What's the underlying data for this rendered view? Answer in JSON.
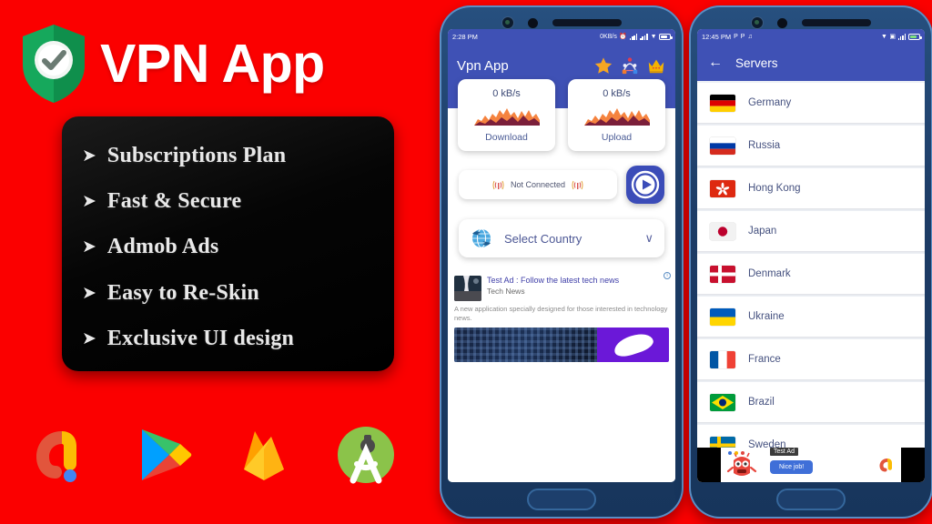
{
  "background_color": "#fb0000",
  "brand": {
    "icon": "shield-check-icon",
    "title": "VPN App"
  },
  "features": {
    "bullet": "➤",
    "items": [
      "Subscriptions Plan",
      "Fast & Secure",
      "Admob Ads",
      "Easy to Re-Skin",
      "Exclusive UI design"
    ]
  },
  "tech_icons": [
    {
      "name": "admob-icon",
      "label": "AdMob"
    },
    {
      "name": "google-play-icon",
      "label": "Google Play"
    },
    {
      "name": "firebase-icon",
      "label": "Firebase"
    },
    {
      "name": "android-studio-icon",
      "label": "Android Studio"
    }
  ],
  "phone_home": {
    "statusbar": {
      "time": "2:28 PM",
      "network_speed": "0KB/s",
      "icons": [
        "alarm-icon",
        "signal-icon",
        "signal-icon",
        "wifi-icon",
        "battery-icon"
      ]
    },
    "appbar": {
      "title": "Vpn App",
      "icons": [
        "star-icon",
        "share-network-icon",
        "crown-icon"
      ]
    },
    "speed_cards": [
      {
        "value": "0 kB/s",
        "label": "Download",
        "graph": "sparkline-graph"
      },
      {
        "value": "0 kB/s",
        "label": "Upload",
        "graph": "sparkline-graph"
      }
    ],
    "connection": {
      "status": "Not Connected",
      "left_icon": "antenna-icon",
      "right_icon": "antenna-icon",
      "play_button": "play-icon"
    },
    "country_selector": {
      "icon": "globe-icon",
      "label": "Select Country",
      "chevron": "∨"
    },
    "native_ad": {
      "info_badge": "i",
      "title": "Test Ad : Follow the latest tech news",
      "advertiser": "Tech News",
      "description": "A new application specially designed for those interested in technology news."
    }
  },
  "phone_servers": {
    "statusbar": {
      "time": "12:45 PM",
      "icons": [
        "p-icon",
        "p-icon",
        "vibrate-icon",
        "wifi-icon",
        "sim-icon",
        "signal-icon",
        "battery-icon"
      ]
    },
    "appbar": {
      "back_icon": "back-arrow-icon",
      "title": "Servers"
    },
    "servers": [
      {
        "name": "Germany",
        "flag": "flag-de"
      },
      {
        "name": "Russia",
        "flag": "flag-ru"
      },
      {
        "name": "Hong Kong",
        "flag": "flag-hk"
      },
      {
        "name": "Japan",
        "flag": "flag-jp"
      },
      {
        "name": "Denmark",
        "flag": "flag-dk"
      },
      {
        "name": "Ukraine",
        "flag": "flag-ua"
      },
      {
        "name": "France",
        "flag": "flag-fr"
      },
      {
        "name": "Brazil",
        "flag": "flag-br"
      },
      {
        "name": "Sweden",
        "flag": "flag-se"
      }
    ],
    "banner_ad": {
      "tag": "Test Ad",
      "message": "Nice job!",
      "admob_icon": "admob-icon",
      "monster_icon": "monster-icon"
    }
  }
}
